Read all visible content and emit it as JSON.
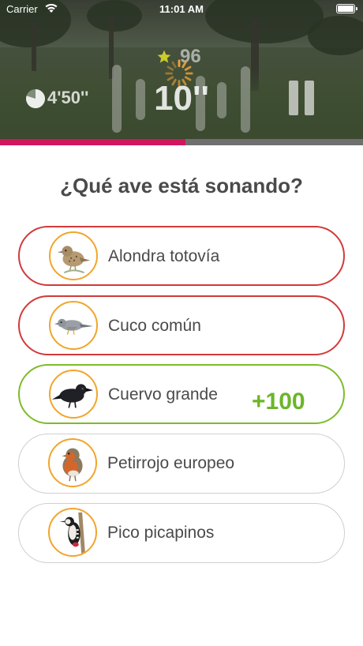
{
  "status_bar": {
    "carrier": "Carrier",
    "time": "11:01 AM",
    "icons": [
      "wifi-icon",
      "battery-icon"
    ]
  },
  "game": {
    "score": "96",
    "total_time": "4'50''",
    "countdown": "10''",
    "progress": 0.51,
    "progress_color": "#d1155f"
  },
  "question": "¿Qué ave está sonando?",
  "answers": [
    {
      "label": "Alondra totovía",
      "state": "wrong",
      "icon": "woodlark-icon"
    },
    {
      "label": "Cuco común",
      "state": "wrong",
      "icon": "cuckoo-icon"
    },
    {
      "label": "Cuervo grande",
      "state": "correct",
      "icon": "raven-icon",
      "points": "+100"
    },
    {
      "label": "Petirrojo europeo",
      "state": "neutral",
      "icon": "robin-icon"
    },
    {
      "label": "Pico picapinos",
      "state": "neutral",
      "icon": "woodpecker-icon"
    }
  ],
  "colors": {
    "wrong": "#d23a3a",
    "correct": "#7cbd28",
    "avatar_ring": "#f2a52a",
    "text": "#4a4a4a"
  }
}
